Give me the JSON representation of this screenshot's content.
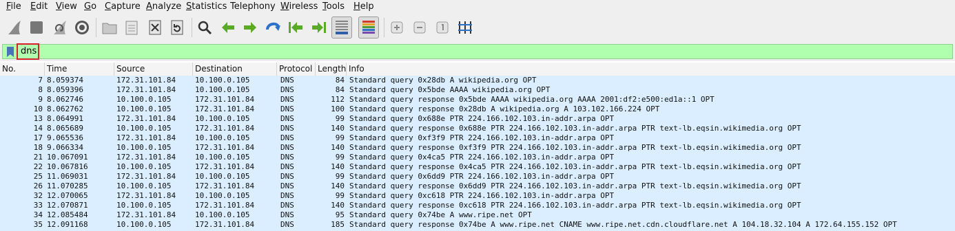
{
  "menu": [
    {
      "mnemonic": "F",
      "rest": "ile"
    },
    {
      "mnemonic": "E",
      "rest": "dit"
    },
    {
      "mnemonic": "V",
      "rest": "iew"
    },
    {
      "mnemonic": "G",
      "rest": "o"
    },
    {
      "mnemonic": "C",
      "rest": "apture"
    },
    {
      "mnemonic": "A",
      "rest": "nalyze"
    },
    {
      "mnemonic": "S",
      "rest": "tatistics"
    },
    {
      "mnemonic": "",
      "rest": "Telephony"
    },
    {
      "mnemonic": "W",
      "rest": "ireless"
    },
    {
      "mnemonic": "T",
      "rest": "ools"
    },
    {
      "mnemonic": "H",
      "rest": "elp"
    }
  ],
  "toolbar_icons": [
    "shark-fin-start-icon",
    "stop-square-icon",
    "restart-fin-icon",
    "capture-options-gear-icon",
    "open-folder-icon",
    "file-set-icon",
    "close-file-icon",
    "reload-icon",
    "find-magnifier-icon",
    "back-arrow-icon",
    "forward-arrow-icon",
    "go-to-packet-icon",
    "first-packet-icon",
    "last-packet-icon",
    "autoscroll-icon",
    "colorize-icon",
    "zoom-in-icon",
    "zoom-out-icon",
    "normal-size-icon",
    "resize-columns-icon"
  ],
  "filter": {
    "value": "dns"
  },
  "columns": [
    "No.",
    "Time",
    "Source",
    "Destination",
    "Protocol",
    "Length",
    "Info"
  ],
  "colors": {
    "row_bg": "#daeeff",
    "filter_bg": "#afffaf",
    "highlight": "#d8202a"
  },
  "packets": [
    {
      "no": "7",
      "time": "8.059374",
      "src": "172.31.101.84",
      "dst": "10.100.0.105",
      "proto": "DNS",
      "len": "84",
      "info": "Standard query 0x28db A wikipedia.org OPT"
    },
    {
      "no": "8",
      "time": "8.059396",
      "src": "172.31.101.84",
      "dst": "10.100.0.105",
      "proto": "DNS",
      "len": "84",
      "info": "Standard query 0x5bde AAAA wikipedia.org OPT"
    },
    {
      "no": "9",
      "time": "8.062746",
      "src": "10.100.0.105",
      "dst": "172.31.101.84",
      "proto": "DNS",
      "len": "112",
      "info": "Standard query response 0x5bde AAAA wikipedia.org AAAA 2001:df2:e500:ed1a::1 OPT"
    },
    {
      "no": "10",
      "time": "8.062762",
      "src": "10.100.0.105",
      "dst": "172.31.101.84",
      "proto": "DNS",
      "len": "100",
      "info": "Standard query response 0x28db A wikipedia.org A 103.102.166.224 OPT"
    },
    {
      "no": "13",
      "time": "8.064991",
      "src": "172.31.101.84",
      "dst": "10.100.0.105",
      "proto": "DNS",
      "len": "99",
      "info": "Standard query 0x688e PTR 224.166.102.103.in-addr.arpa OPT"
    },
    {
      "no": "14",
      "time": "8.065689",
      "src": "10.100.0.105",
      "dst": "172.31.101.84",
      "proto": "DNS",
      "len": "140",
      "info": "Standard query response 0x688e PTR 224.166.102.103.in-addr.arpa PTR text-lb.eqsin.wikimedia.org OPT"
    },
    {
      "no": "17",
      "time": "9.065536",
      "src": "172.31.101.84",
      "dst": "10.100.0.105",
      "proto": "DNS",
      "len": "99",
      "info": "Standard query 0xf3f9 PTR 224.166.102.103.in-addr.arpa OPT"
    },
    {
      "no": "18",
      "time": "9.066334",
      "src": "10.100.0.105",
      "dst": "172.31.101.84",
      "proto": "DNS",
      "len": "140",
      "info": "Standard query response 0xf3f9 PTR 224.166.102.103.in-addr.arpa PTR text-lb.eqsin.wikimedia.org OPT"
    },
    {
      "no": "21",
      "time": "10.067091",
      "src": "172.31.101.84",
      "dst": "10.100.0.105",
      "proto": "DNS",
      "len": "99",
      "info": "Standard query 0x4ca5 PTR 224.166.102.103.in-addr.arpa OPT"
    },
    {
      "no": "22",
      "time": "10.067816",
      "src": "10.100.0.105",
      "dst": "172.31.101.84",
      "proto": "DNS",
      "len": "140",
      "info": "Standard query response 0x4ca5 PTR 224.166.102.103.in-addr.arpa PTR text-lb.eqsin.wikimedia.org OPT"
    },
    {
      "no": "25",
      "time": "11.069031",
      "src": "172.31.101.84",
      "dst": "10.100.0.105",
      "proto": "DNS",
      "len": "99",
      "info": "Standard query 0x6dd9 PTR 224.166.102.103.in-addr.arpa OPT"
    },
    {
      "no": "26",
      "time": "11.070285",
      "src": "10.100.0.105",
      "dst": "172.31.101.84",
      "proto": "DNS",
      "len": "140",
      "info": "Standard query response 0x6dd9 PTR 224.166.102.103.in-addr.arpa PTR text-lb.eqsin.wikimedia.org OPT"
    },
    {
      "no": "32",
      "time": "12.070065",
      "src": "172.31.101.84",
      "dst": "10.100.0.105",
      "proto": "DNS",
      "len": "99",
      "info": "Standard query 0xc618 PTR 224.166.102.103.in-addr.arpa OPT"
    },
    {
      "no": "33",
      "time": "12.070871",
      "src": "10.100.0.105",
      "dst": "172.31.101.84",
      "proto": "DNS",
      "len": "140",
      "info": "Standard query response 0xc618 PTR 224.166.102.103.in-addr.arpa PTR text-lb.eqsin.wikimedia.org OPT"
    },
    {
      "no": "34",
      "time": "12.085484",
      "src": "172.31.101.84",
      "dst": "10.100.0.105",
      "proto": "DNS",
      "len": "95",
      "info": "Standard query 0x74be A www.ripe.net OPT"
    },
    {
      "no": "35",
      "time": "12.091168",
      "src": "10.100.0.105",
      "dst": "172.31.101.84",
      "proto": "DNS",
      "len": "185",
      "info": "Standard query response 0x74be A www.ripe.net CNAME www.ripe.net.cdn.cloudflare.net A 104.18.32.104 A 172.64.155.152 OPT"
    }
  ]
}
